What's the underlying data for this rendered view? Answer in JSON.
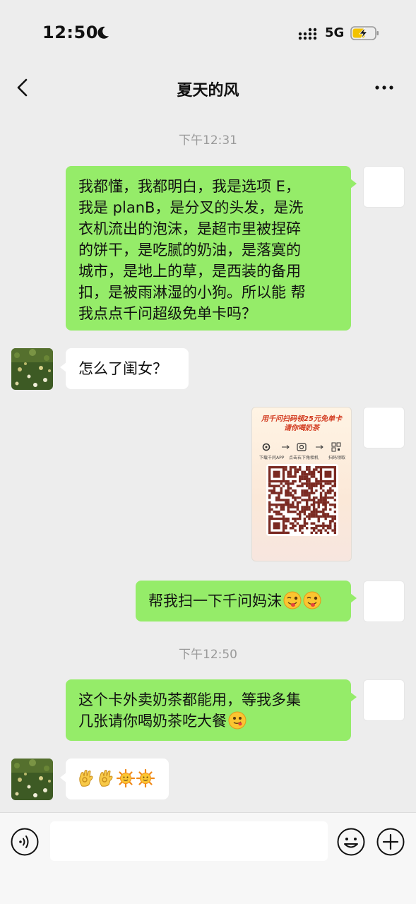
{
  "status_bar": {
    "time": "12:50",
    "network": "5G"
  },
  "header": {
    "title": "夏天的风"
  },
  "messages": {
    "ts1": "下午12:31",
    "m1_lines": [
      "我都懂，我都明白，我是选项 E，",
      "我是 planB，是分叉的头发，是洗",
      "衣机流出的泡沫，是超市里被捏碎",
      "的饼干，是吃腻的奶油，是落寞的",
      "城市，是地上的草，是西装的备用",
      "扣，是被雨淋湿的小狗。所以能 帮",
      "我点点千问超级免单卡吗？"
    ],
    "m2": "怎么了闺女？",
    "card": {
      "title_line1": "用千问扫码领25元免单卡",
      "title_line2": "请你喝奶茶",
      "step1": "下载千问APP",
      "step2": "点击右下角相机",
      "step3": "扫码领取"
    },
    "m4_text": "帮我扫一下千问妈沫",
    "m4_emojis": [
      "winking-tongue-face",
      "winking-tongue-face"
    ],
    "ts2": "下午12:50",
    "m5_line1": "这个卡外卖奶茶都能用，等我多集",
    "m5_line2": "几张请你喝奶茶吃大餐",
    "m5_emoji": "tongue-out-face",
    "m6_emojis": [
      "ok-hand",
      "ok-hand",
      "sun-face",
      "sun-face"
    ]
  },
  "input_bar": {
    "placeholder": ""
  },
  "colors": {
    "outgoing_bubble": "#95ec69",
    "incoming_bubble": "#ffffff",
    "background": "#ededed"
  }
}
